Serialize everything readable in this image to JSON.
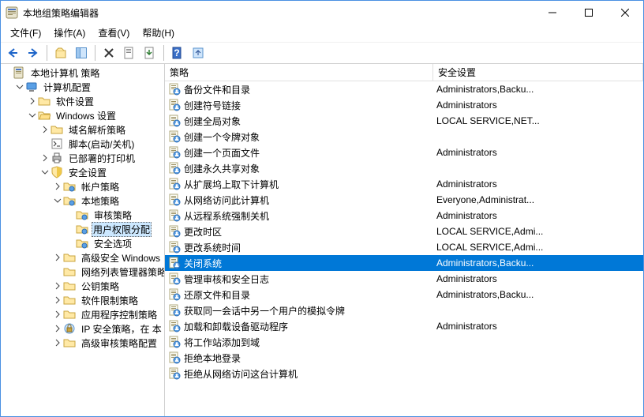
{
  "window": {
    "title": "本地组策略编辑器"
  },
  "menu": {
    "file": "文件(F)",
    "action": "操作(A)",
    "view": "查看(V)",
    "help": "帮助(H)"
  },
  "list": {
    "columns": {
      "policy": "策略",
      "setting": "安全设置"
    },
    "selected_index": 11,
    "items": [
      {
        "name": "备份文件和目录",
        "setting": "Administrators,Backu..."
      },
      {
        "name": "创建符号链接",
        "setting": "Administrators"
      },
      {
        "name": "创建全局对象",
        "setting": "LOCAL SERVICE,NET..."
      },
      {
        "name": "创建一个令牌对象",
        "setting": ""
      },
      {
        "name": "创建一个页面文件",
        "setting": "Administrators"
      },
      {
        "name": "创建永久共享对象",
        "setting": ""
      },
      {
        "name": "从扩展坞上取下计算机",
        "setting": "Administrators"
      },
      {
        "name": "从网络访问此计算机",
        "setting": "Everyone,Administrat..."
      },
      {
        "name": "从远程系统强制关机",
        "setting": "Administrators"
      },
      {
        "name": "更改时区",
        "setting": "LOCAL SERVICE,Admi..."
      },
      {
        "name": "更改系统时间",
        "setting": "LOCAL SERVICE,Admi..."
      },
      {
        "name": "关闭系统",
        "setting": "Administrators,Backu..."
      },
      {
        "name": "管理审核和安全日志",
        "setting": "Administrators"
      },
      {
        "name": "还原文件和目录",
        "setting": "Administrators,Backu..."
      },
      {
        "name": "获取同一会话中另一个用户的模拟令牌",
        "setting": ""
      },
      {
        "name": "加载和卸载设备驱动程序",
        "setting": "Administrators"
      },
      {
        "name": "将工作站添加到域",
        "setting": ""
      },
      {
        "name": "拒绝本地登录",
        "setting": ""
      },
      {
        "name": "拒绝从网络访问这台计算机",
        "setting": ""
      }
    ]
  },
  "tree": {
    "selected_path": "用户权限分配",
    "nodes": [
      {
        "depth": 0,
        "label": "本地计算机 策略",
        "icon": "policy-doc",
        "expander": "none"
      },
      {
        "depth": 1,
        "label": "计算机配置",
        "icon": "computer",
        "expander": "open"
      },
      {
        "depth": 2,
        "label": "软件设置",
        "icon": "folder",
        "expander": "closed"
      },
      {
        "depth": 2,
        "label": "Windows 设置",
        "icon": "folder-open",
        "expander": "open"
      },
      {
        "depth": 3,
        "label": "域名解析策略",
        "icon": "folder",
        "expander": "closed"
      },
      {
        "depth": 3,
        "label": "脚本(启动/关机)",
        "icon": "script",
        "expander": "none"
      },
      {
        "depth": 3,
        "label": "已部署的打印机",
        "icon": "printer",
        "expander": "closed"
      },
      {
        "depth": 3,
        "label": "安全设置",
        "icon": "shield",
        "expander": "open"
      },
      {
        "depth": 4,
        "label": "帐户策略",
        "icon": "folder-acc",
        "expander": "closed"
      },
      {
        "depth": 4,
        "label": "本地策略",
        "icon": "folder-acc",
        "expander": "open"
      },
      {
        "depth": 5,
        "label": "审核策略",
        "icon": "folder-acc",
        "expander": "none"
      },
      {
        "depth": 5,
        "label": "用户权限分配",
        "icon": "folder-acc",
        "expander": "none",
        "selected": true
      },
      {
        "depth": 5,
        "label": "安全选项",
        "icon": "folder-acc",
        "expander": "none"
      },
      {
        "depth": 4,
        "label": "高级安全 Windows",
        "icon": "folder",
        "expander": "closed"
      },
      {
        "depth": 4,
        "label": "网络列表管理器策略",
        "icon": "folder",
        "expander": "none"
      },
      {
        "depth": 4,
        "label": "公钥策略",
        "icon": "folder",
        "expander": "closed"
      },
      {
        "depth": 4,
        "label": "软件限制策略",
        "icon": "folder",
        "expander": "closed"
      },
      {
        "depth": 4,
        "label": "应用程序控制策略",
        "icon": "folder",
        "expander": "closed"
      },
      {
        "depth": 4,
        "label": "IP 安全策略，在 本",
        "icon": "ipsec",
        "expander": "closed"
      },
      {
        "depth": 4,
        "label": "高级审核策略配置",
        "icon": "folder",
        "expander": "closed"
      }
    ]
  }
}
